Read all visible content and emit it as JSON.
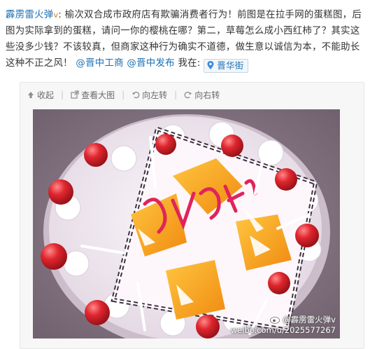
{
  "post": {
    "author": "霹雳雷火弹",
    "author_badge": "v",
    "separator": ":",
    "body": "榆次双合成市政府店有欺骗消费者行为！前图是在拉手网的蛋糕图，后图为实际拿到的蛋糕，请问一你的樱桃在哪？第二，草莓怎么成小西红柿了？其实这些没多少钱？不该较真，但商家这种行为确实不道德，做生意以诚信为本，不能助长这种不正之风！",
    "mention_1": "@晋中工商",
    "mention_2": "@晋中发布",
    "location_prefix": "我在:",
    "location": "晋华街"
  },
  "toolbar": {
    "collapse": "收起",
    "view_large": "查看大图",
    "rotate_left": "向左转",
    "rotate_right": "向右转"
  },
  "watermark": {
    "line1": "@霹雳雷火弹v",
    "line2": "weibo.com/u/2025577267"
  },
  "colors": {
    "link": "#1a6fb3",
    "badge": "#e07a18",
    "toolbar_text": "#6a6a6a"
  }
}
